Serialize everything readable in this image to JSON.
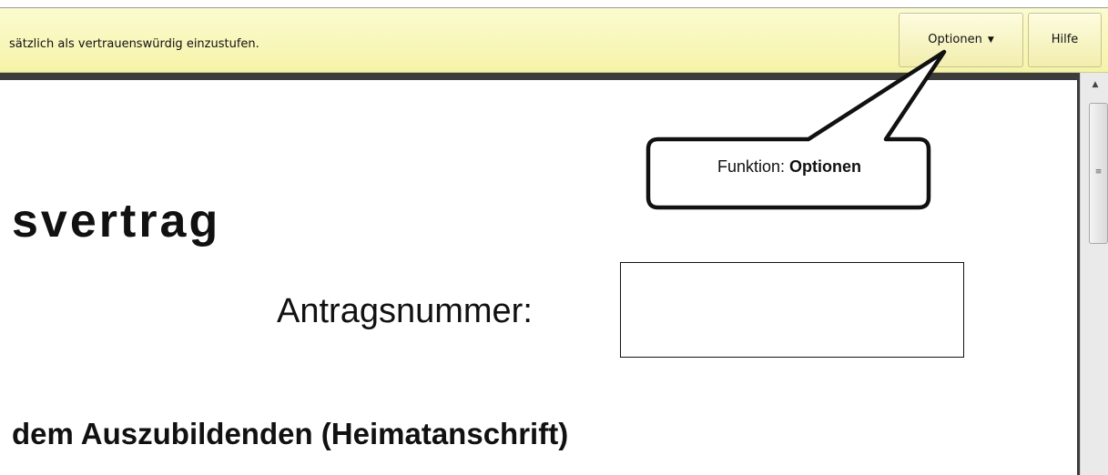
{
  "notification_bar": {
    "message": "sätzlich als vertrauenswürdig einzustufen.",
    "options_label": "Optionen",
    "options_caret": "▼",
    "help_label": "Hilfe"
  },
  "document": {
    "title_fragment": "svertrag",
    "application_number_label": "Antragsnummer:",
    "application_number_value": "",
    "section_heading": "dem Auszubildenden (Heimatanschrift)"
  },
  "callout": {
    "prefix": "Funktion: ",
    "bold_text": "Optionen"
  },
  "scrollbar": {
    "up_arrow": "▲",
    "grip": "≡"
  }
}
